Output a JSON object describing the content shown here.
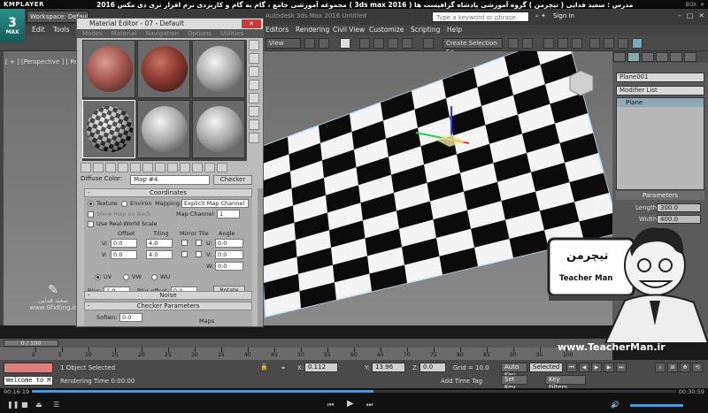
{
  "kmplayer": {
    "logo": "KMPLAYER",
    "video_title": "مجموعه آموزشی جامع ، گام به گام و کاربردی نرم افزار تری دی مکس 2016 ( 3ds max 2016 ) مدرس : سعید فدایی ( تیچرمن ) گروه آموزشی پادشاه گرافیست ها",
    "right_icons": [
      "BOX",
      "close-icon"
    ],
    "time_current": "00:16:19",
    "time_total": "00:30:59",
    "progress": 0.53
  },
  "max_title_bar": {
    "logo_text": "MAX",
    "workspace_label": "Workspace: Default",
    "project_title": "Autodesk 3ds Max 2016   Untitled",
    "search_placeholder": "Type a keyword or phrase",
    "sign_in": "Sign In"
  },
  "menu": [
    "Edit",
    "Tools",
    "Editors",
    "Rendering",
    "Civil View",
    "Customize",
    "Scripting",
    "Help"
  ],
  "toolbar": {
    "view_dropdown": "View",
    "selection_set": "Create Selection Se"
  },
  "viewport": {
    "label": "[ + ] [Perspective ] [ Realistic ]"
  },
  "material_editor": {
    "title": "Material Editor - 07 - Default",
    "menu": [
      "Modes",
      "Material",
      "Navigation",
      "Options",
      "Utilities"
    ],
    "diffuse_label": "Diffuse Color:",
    "map_name": "Map #4",
    "map_type": "Checker",
    "coordinates": {
      "header": "Coordinates",
      "texture": "Texture",
      "environ": "Environ",
      "mapping_label": "Mapping:",
      "mapping_value": "Explicit Map Channel",
      "show_map": "Show Map on Back",
      "map_channel_label": "Map Channel:",
      "map_channel_value": "1",
      "real_world": "Use Real-World Scale",
      "offset": "Offset",
      "tiling": "Tiling",
      "mirror_tile": "Mirror Tile",
      "angle": "Angle",
      "u_label": "U:",
      "v_label": "V:",
      "w_label": "W:",
      "u_offset": "0.0",
      "v_offset": "0.0",
      "u_tiling": "4.0",
      "v_tiling": "4.0",
      "u_angle": "0.0",
      "v_angle": "0.0",
      "w_angle": "0.0",
      "uv": "UV",
      "vw": "VW",
      "wu": "WU",
      "blur_label": "Blur:",
      "blur": "1.0",
      "blur_offset_label": "Blur offset:",
      "blur_offset": "0.0",
      "rotate": "Rotate"
    },
    "noise": {
      "header": "Noise"
    },
    "checker_params": {
      "header": "Checker Parameters",
      "soften_label": "Soften:",
      "soften": "0.0",
      "maps_label": "Maps"
    }
  },
  "command_panel": {
    "object_name": "Plane001",
    "modifier_list": "Modifier List",
    "stack_item": "Plane",
    "params_header": "Parameters",
    "length_label": "Length:",
    "length": "300.0",
    "width_label": "Width:",
    "width": "400.0"
  },
  "overlay": {
    "teacher_fa": "تیچرمن",
    "teacher_en": "Teacher Man",
    "url": "www.TeacherMan.ir",
    "watermark_name": "سعید فدایی",
    "watermark_url": "www.GfxKing.ir"
  },
  "timeline": {
    "slider": "0 / 100",
    "ticks": [
      "0",
      "5",
      "10",
      "15",
      "20",
      "25",
      "30",
      "35",
      "40",
      "45",
      "50",
      "55",
      "60",
      "65",
      "70",
      "75",
      "80",
      "85",
      "90",
      "95",
      "100"
    ]
  },
  "status": {
    "selection": "1 Object Selected",
    "render_time": "Rendering Time  0:00:00",
    "welcome": "Welcome to M",
    "x_label": "X:",
    "x_value": "0.112",
    "y_label": "Y:",
    "y_value": "13.96",
    "z_label": "Z:",
    "z_value": "0.0",
    "grid": "Grid = 10.0",
    "add_time_tag": "Add Time Tag",
    "auto_key": "Auto Key",
    "selected": "Selected",
    "set_key": "Set Key",
    "key_filters": "Key Filters..."
  },
  "colors": {
    "max_bg": "#444444",
    "viewport_top": "#6d6d6d",
    "progress": "#3f9ee6",
    "auto_key_red": "#e07d7d"
  }
}
